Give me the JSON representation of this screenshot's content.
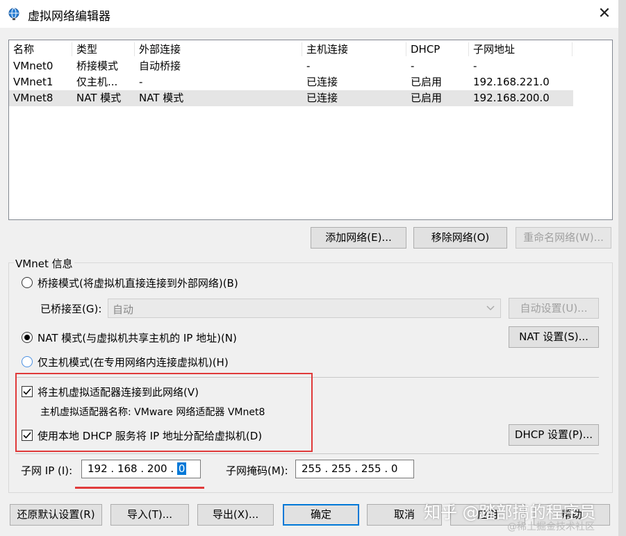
{
  "window": {
    "title": "虚拟网络编辑器",
    "close_symbol": "✕"
  },
  "list": {
    "headers": [
      "名称",
      "类型",
      "外部连接",
      "主机连接",
      "DHCP",
      "子网地址"
    ],
    "rows": [
      [
        "VMnet0",
        "桥接模式",
        "自动桥接",
        "-",
        "-",
        "-"
      ],
      [
        "VMnet1",
        "仅主机...",
        "-",
        "已连接",
        "已启用",
        "192.168.221.0"
      ],
      [
        "VMnet8",
        "NAT 模式",
        "NAT 模式",
        "已连接",
        "已启用",
        "192.168.200.0"
      ]
    ],
    "selected_row": 2
  },
  "list_buttons": {
    "add": "添加网络(E)...",
    "remove": "移除网络(O)",
    "rename": "重命名网络(W)..."
  },
  "vmnet_info": {
    "group_label": "VMnet 信息",
    "bridge_radio": "桥接模式(将虚拟机直接连接到外部网络)(B)",
    "bridged_to_label": "已桥接至(G):",
    "bridged_to_value": "自动",
    "auto_settings": "自动设置(U)...",
    "nat_radio": "NAT 模式(与虚拟机共享主机的 IP 地址)(N)",
    "nat_settings": "NAT 设置(S)...",
    "hostonly_radio": "仅主机模式(在专用网络内连接虚拟机)(H)",
    "connect_adapter": "将主机虚拟适配器连接到此网络(V)",
    "adapter_name": "主机虚拟适配器名称: VMware 网络适配器 VMnet8",
    "use_dhcp": "使用本地 DHCP 服务将 IP 地址分配给虚拟机(D)",
    "dhcp_settings": "DHCP 设置(P)...",
    "subnet_ip_label": "子网 IP (I):",
    "subnet_ip": [
      "192",
      "168",
      "200",
      "0"
    ],
    "subnet_mask_label": "子网掩码(M):",
    "subnet_mask": [
      "255",
      "255",
      "255",
      "0"
    ]
  },
  "bottom_buttons": {
    "restore": "还原默认设置(R)",
    "import": "导入(T)...",
    "export": "导出(X)...",
    "ok": "确定",
    "cancel": "取消",
    "apply": "应用",
    "help": "帮助"
  },
  "watermark": {
    "main": "知乎 @踏部搞的程序员",
    "sub": "@稀土掘金技术社区"
  },
  "colors": {
    "highlight": "#0078d7",
    "annotation_red": "#e03a3a",
    "selected_row": "#e5e5e5"
  }
}
